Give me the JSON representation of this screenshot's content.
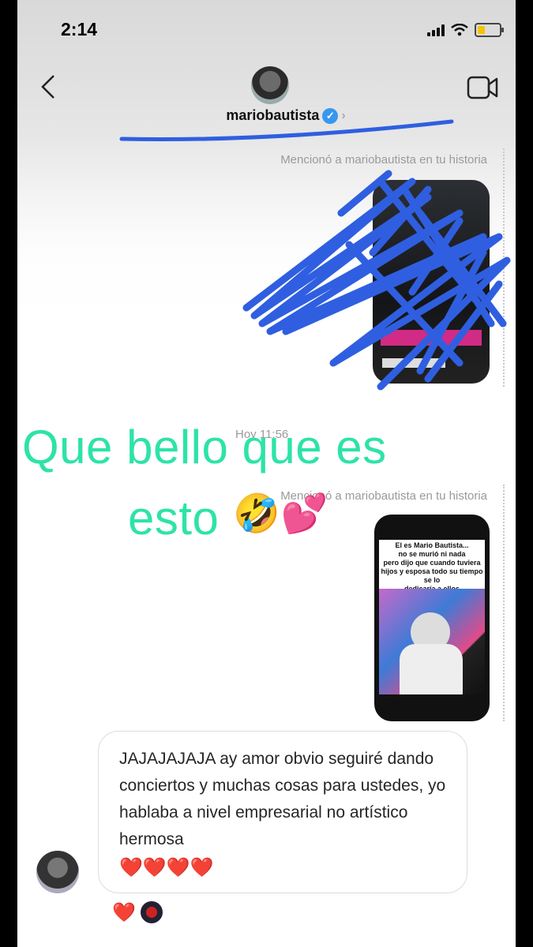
{
  "status": {
    "time": "2:14"
  },
  "header": {
    "username": "mariobautista",
    "verified_icon": "verified-badge-icon",
    "chevron": "›"
  },
  "messages": {
    "mention_1": "Mencionó a mariobautista en tu historia",
    "mention_2": "Mencionó a mariobautista en tu historia",
    "time": "Hoy 11:56",
    "story2": {
      "text": "El es Mario Bautista...\nno se murió ni nada\npero dijo que cuando tuviera\nhijos y esposa todo su tiempo se lo\ndedicaría a ellos"
    },
    "reply": "JAJAJAJAJA ay amor obvio seguiré dando conciertos y muchas cosas para ustedes, yo hablaba a nivel empresarial no artístico hermosa",
    "reply_emojis": "❤️❤️❤️❤️",
    "reaction": "❤️"
  },
  "overlay": {
    "line1": "Que bello que es",
    "line2": "esto",
    "emojis": "🤣💕"
  },
  "colors": {
    "overlay_text": "#2de3a8",
    "scribble": "#2f5fe0",
    "verified": "#3897f0"
  }
}
